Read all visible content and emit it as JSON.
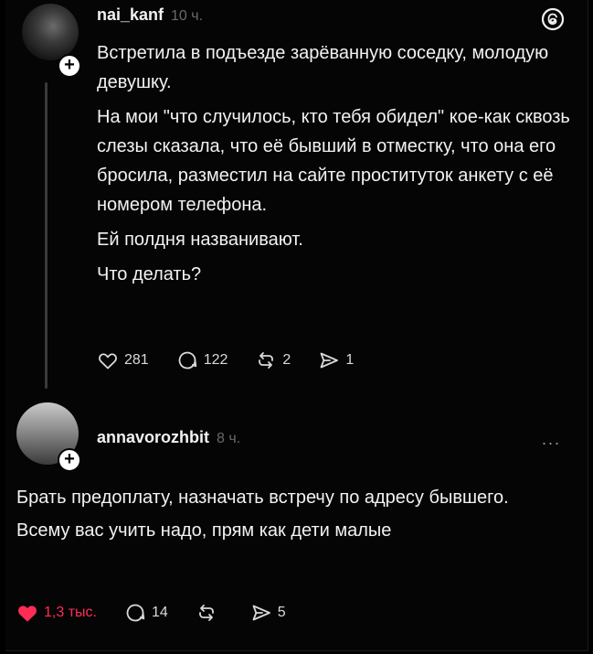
{
  "post": {
    "username": "nai_kanf",
    "time": "10 ч.",
    "lines": [
      "Встретила в подъезде зарёванную соседку, молодую девушку.",
      "На мои \"что случилось, кто тебя обидел\" кое-как сквозь слезы сказала, что её бывший в отместку, что она его бросила, разместил на сайте проституток анкету с её номером телефона.",
      "Ей полдня названивают.",
      "Что делать?"
    ],
    "likes": "281",
    "comments": "122",
    "reposts": "2",
    "shares": "1"
  },
  "reply": {
    "username": "annavorozhbit",
    "time": "8 ч.",
    "more": "...",
    "lines": [
      "Брать предоплату, назначать встречу по адресу бывшего.",
      "Всему вас учить надо, прям как дети малые"
    ],
    "likes": "1,3 тыс.",
    "comments": "14",
    "reposts": "",
    "shares": "5"
  },
  "icons": {
    "heart": "heart-icon",
    "comment": "comment-icon",
    "repost": "repost-icon",
    "share": "share-icon",
    "threads": "threads-logo-icon",
    "plus": "plus-icon"
  },
  "colors": {
    "background": "#000000",
    "text": "#f2f2f2",
    "muted": "#6a6a6a",
    "like": "#ff2d55"
  }
}
